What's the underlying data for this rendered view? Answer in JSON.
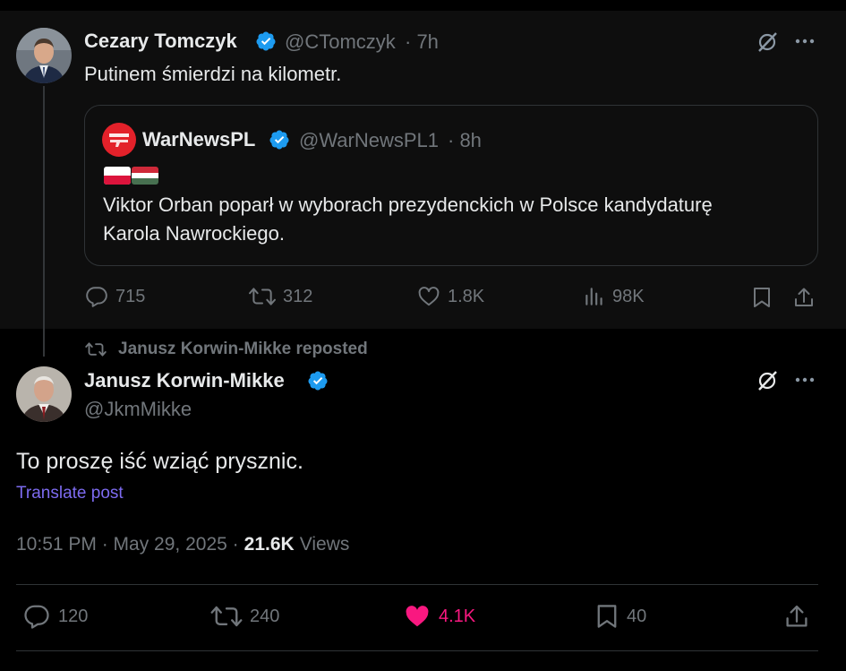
{
  "parent": {
    "name": "Cezary Tomczyk",
    "handle": "@CTomczyk",
    "time": "· 7h",
    "text": "Putinem śmierdzi na kilometr.",
    "quote": {
      "name": "WarNewsPL",
      "handle": "@WarNewsPL1",
      "time": "· 8h",
      "flags": [
        "PL",
        "HU"
      ],
      "line1": "Viktor Orban poparł w wyborach prezydenckich w Polsce kandydaturę",
      "line2": "Karola Nawrockiego."
    },
    "actions": {
      "replies": "715",
      "reposts": "312",
      "likes": "1.8K",
      "views": "98K"
    }
  },
  "main": {
    "repost_label": "Janusz Korwin-Mikke reposted",
    "name": "Janusz Korwin-Mikke",
    "handle": "@JkmMikke",
    "text": "To proszę iść wziąć prysznic.",
    "translate": "Translate post",
    "timestamp": "10:51 PM · May 29, 2025 ·",
    "views_count": "21.6K",
    "views_label": "Views",
    "actions": {
      "replies": "120",
      "reposts": "240",
      "likes": "4.1K",
      "bookmarks": "40"
    }
  },
  "colors": {
    "background": "#000000",
    "parent_background": "#0e0e0e",
    "text": "#e7e9ea",
    "muted": "#71767b",
    "verified": "#1d9bf0",
    "like_active": "#f91880",
    "translate_link": "#7d6bf0"
  },
  "icons": [
    "grok-icon",
    "more-icon",
    "reply-icon",
    "repost-icon",
    "like-icon",
    "views-icon",
    "bookmark-icon",
    "share-icon",
    "verified-icon"
  ]
}
